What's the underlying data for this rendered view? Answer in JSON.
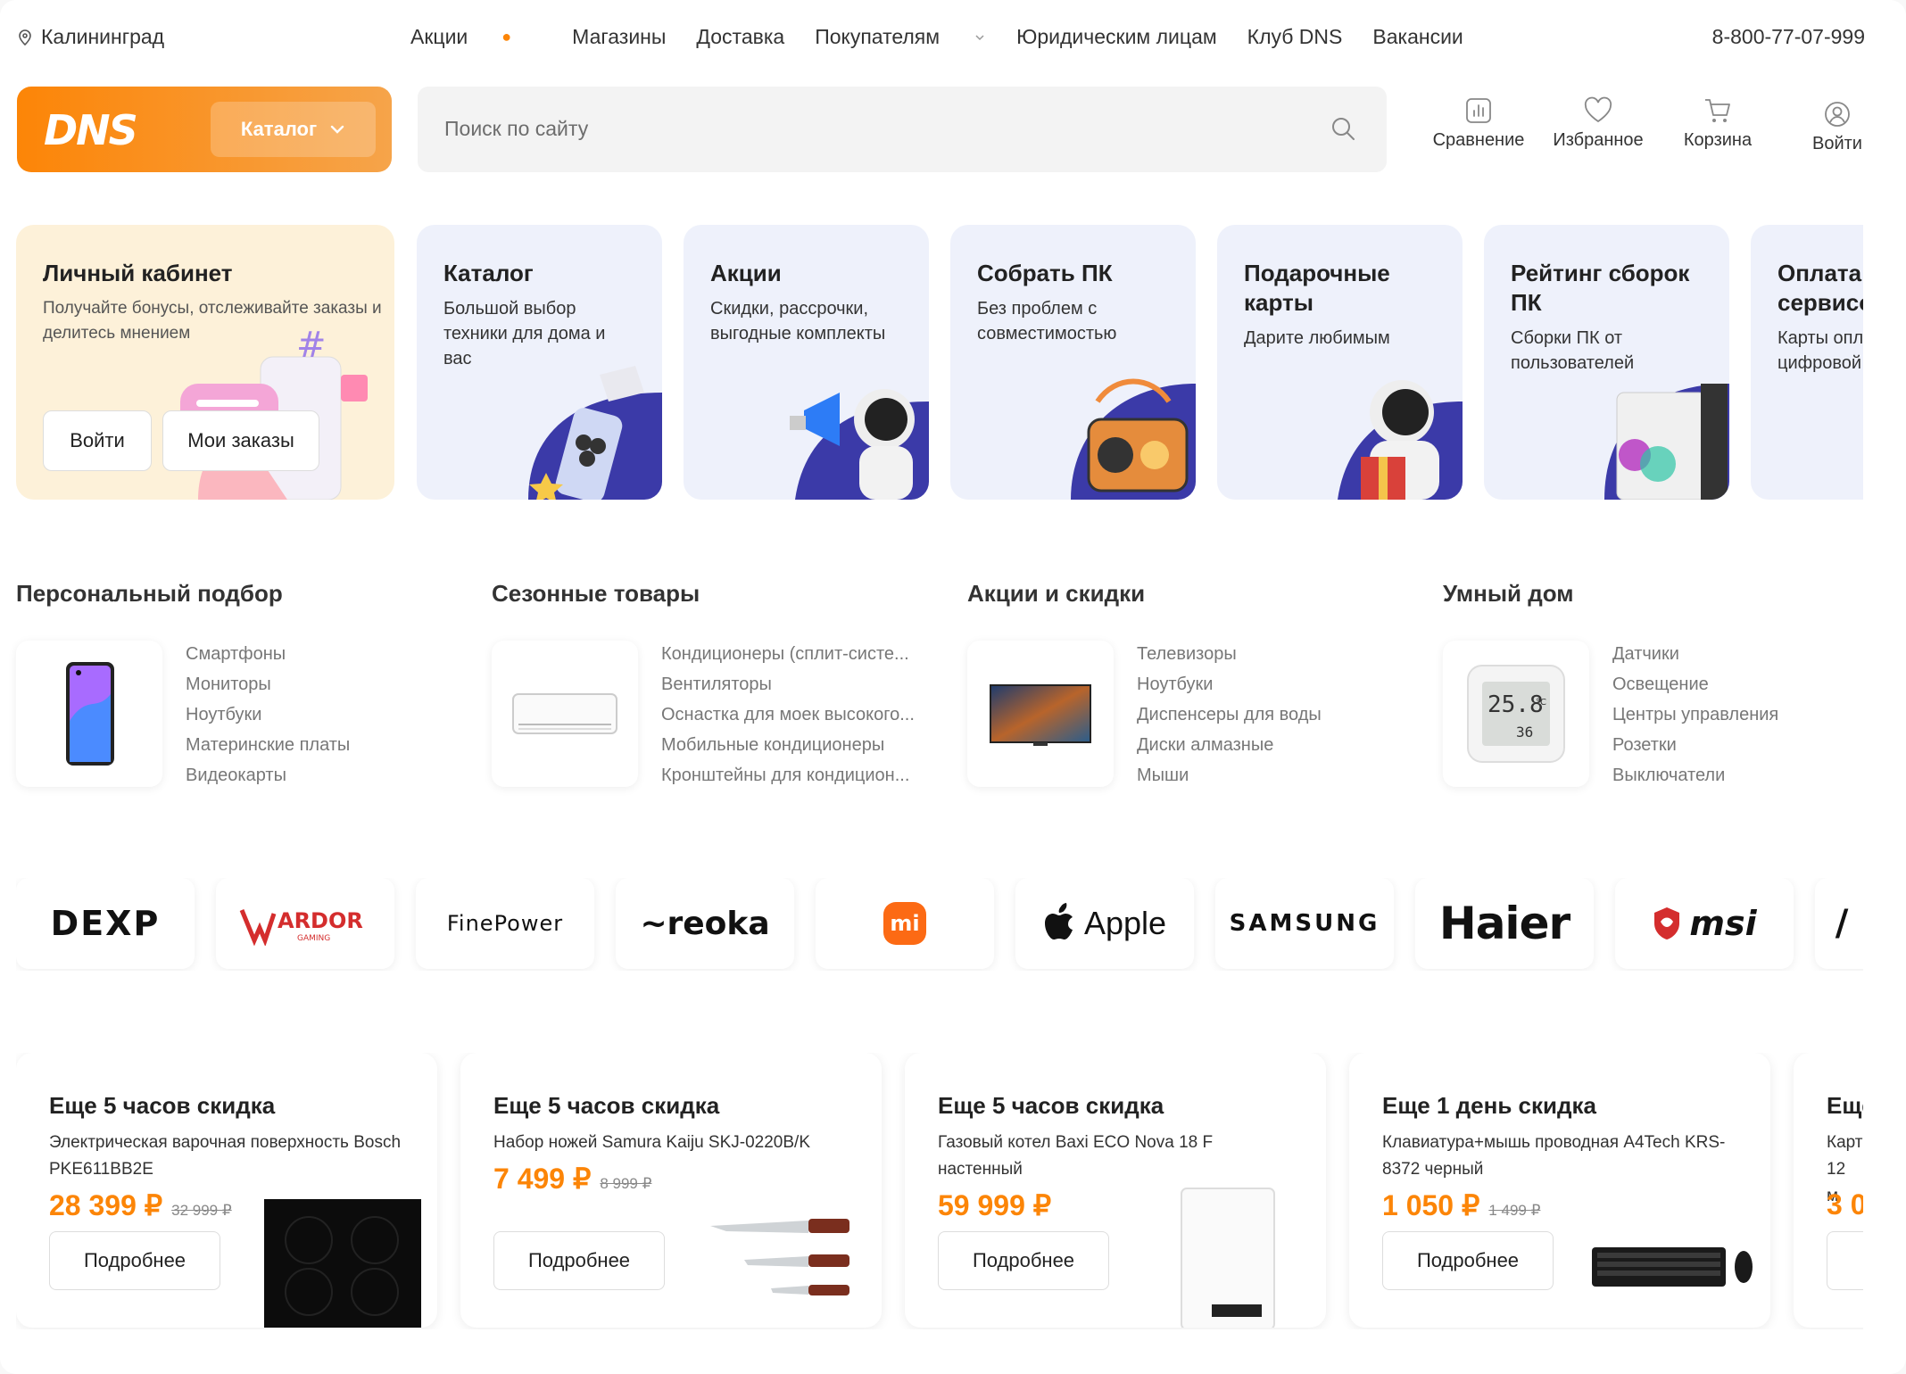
{
  "topbar": {
    "city": "Калининград",
    "nav": [
      "Акции",
      "Магазины",
      "Доставка",
      "Покупателям",
      "Юридическим лицам",
      "Клуб DNS",
      "Вакансии"
    ],
    "phone": "8-800-77-07-999"
  },
  "header": {
    "logo": "DNS",
    "catalog_label": "Каталог",
    "search_placeholder": "Поиск по сайту",
    "icons": {
      "compare": "Сравнение",
      "favorites": "Избранное",
      "cart": "Корзина",
      "login": "Войти"
    }
  },
  "promos": [
    {
      "title": "Личный кабинет",
      "text": "Получайте бонусы, отслеживайте заказы и делитесь мнением",
      "btn1": "Войти",
      "btn2": "Мои заказы"
    },
    {
      "title": "Каталог",
      "text": "Большой выбор техники для дома и вас"
    },
    {
      "title": "Акции",
      "text": "Скидки, рассрочки, выгодные комплекты"
    },
    {
      "title": "Собрать ПК",
      "text": "Без проблем с совместимостью"
    },
    {
      "title": "Подарочные карты",
      "text": "Дарите любимым"
    },
    {
      "title": "Рейтинг сборок ПК",
      "text": "Сборки ПК от пользователей"
    },
    {
      "title": "Оплата и сервисов",
      "text": "Карты опла цифровой"
    }
  ],
  "sections": [
    {
      "title": "Персональный подбор",
      "items": [
        "Смартфоны",
        "Мониторы",
        "Ноутбуки",
        "Материнские платы",
        "Видеокарты"
      ]
    },
    {
      "title": "Сезонные товары",
      "items": [
        "Кондиционеры (сплит-систе...",
        "Вентиляторы",
        "Оснастка для моек высокого...",
        "Мобильные кондиционеры",
        "Кронштейны для кондицион..."
      ]
    },
    {
      "title": "Акции и скидки",
      "items": [
        "Телевизоры",
        "Ноутбуки",
        "Диспенсеры для воды",
        "Диски алмазные",
        "Мыши"
      ]
    },
    {
      "title": "Умный дом",
      "items": [
        "Датчики",
        "Освещение",
        "Центры управления",
        "Розетки",
        "Выключатели"
      ]
    }
  ],
  "brands": [
    "DEXP",
    "ARDOR",
    "FinePower",
    "reoka",
    "mi",
    "Apple",
    "SAMSUNG",
    "Haier",
    "msi"
  ],
  "brand_sublabels": {
    "ardor": "GAMING"
  },
  "thermo": {
    "temp": "25.8",
    "unit": "°C",
    "humidity": "36"
  },
  "deals": [
    {
      "title": "Еще 5 часов скидка",
      "name": "Электрическая варочная поверхность Bosch PKE611BB2E",
      "price": "28 399 ₽",
      "old": "32 999 ₽",
      "more": "Подробнее"
    },
    {
      "title": "Еще 5 часов скидка",
      "name": "Набор ножей Samura Kaiju SKJ-0220B/K",
      "price": "7 499 ₽",
      "old": "8 999 ₽",
      "more": "Подробнее"
    },
    {
      "title": "Еще 5 часов скидка",
      "name": "Газовый котел Baxi ECO Nova 18 F настенный",
      "price": "59 999 ₽",
      "old": "",
      "more": "Подробнее"
    },
    {
      "title": "Еще 1 день скидка",
      "name": "Клавиатура+мышь проводная A4Tech KRS-8372 черный",
      "price": "1 050 ₽",
      "old": "1 499 ₽",
      "more": "Подробнее"
    },
    {
      "title": "Еще",
      "name": "Карт 12 м",
      "price": "3 0",
      "old": "",
      "more": ""
    }
  ],
  "colors": {
    "accent": "#fc8507",
    "promo_bg": "#eef1fb",
    "personal_bg": "#fdf1d9"
  }
}
